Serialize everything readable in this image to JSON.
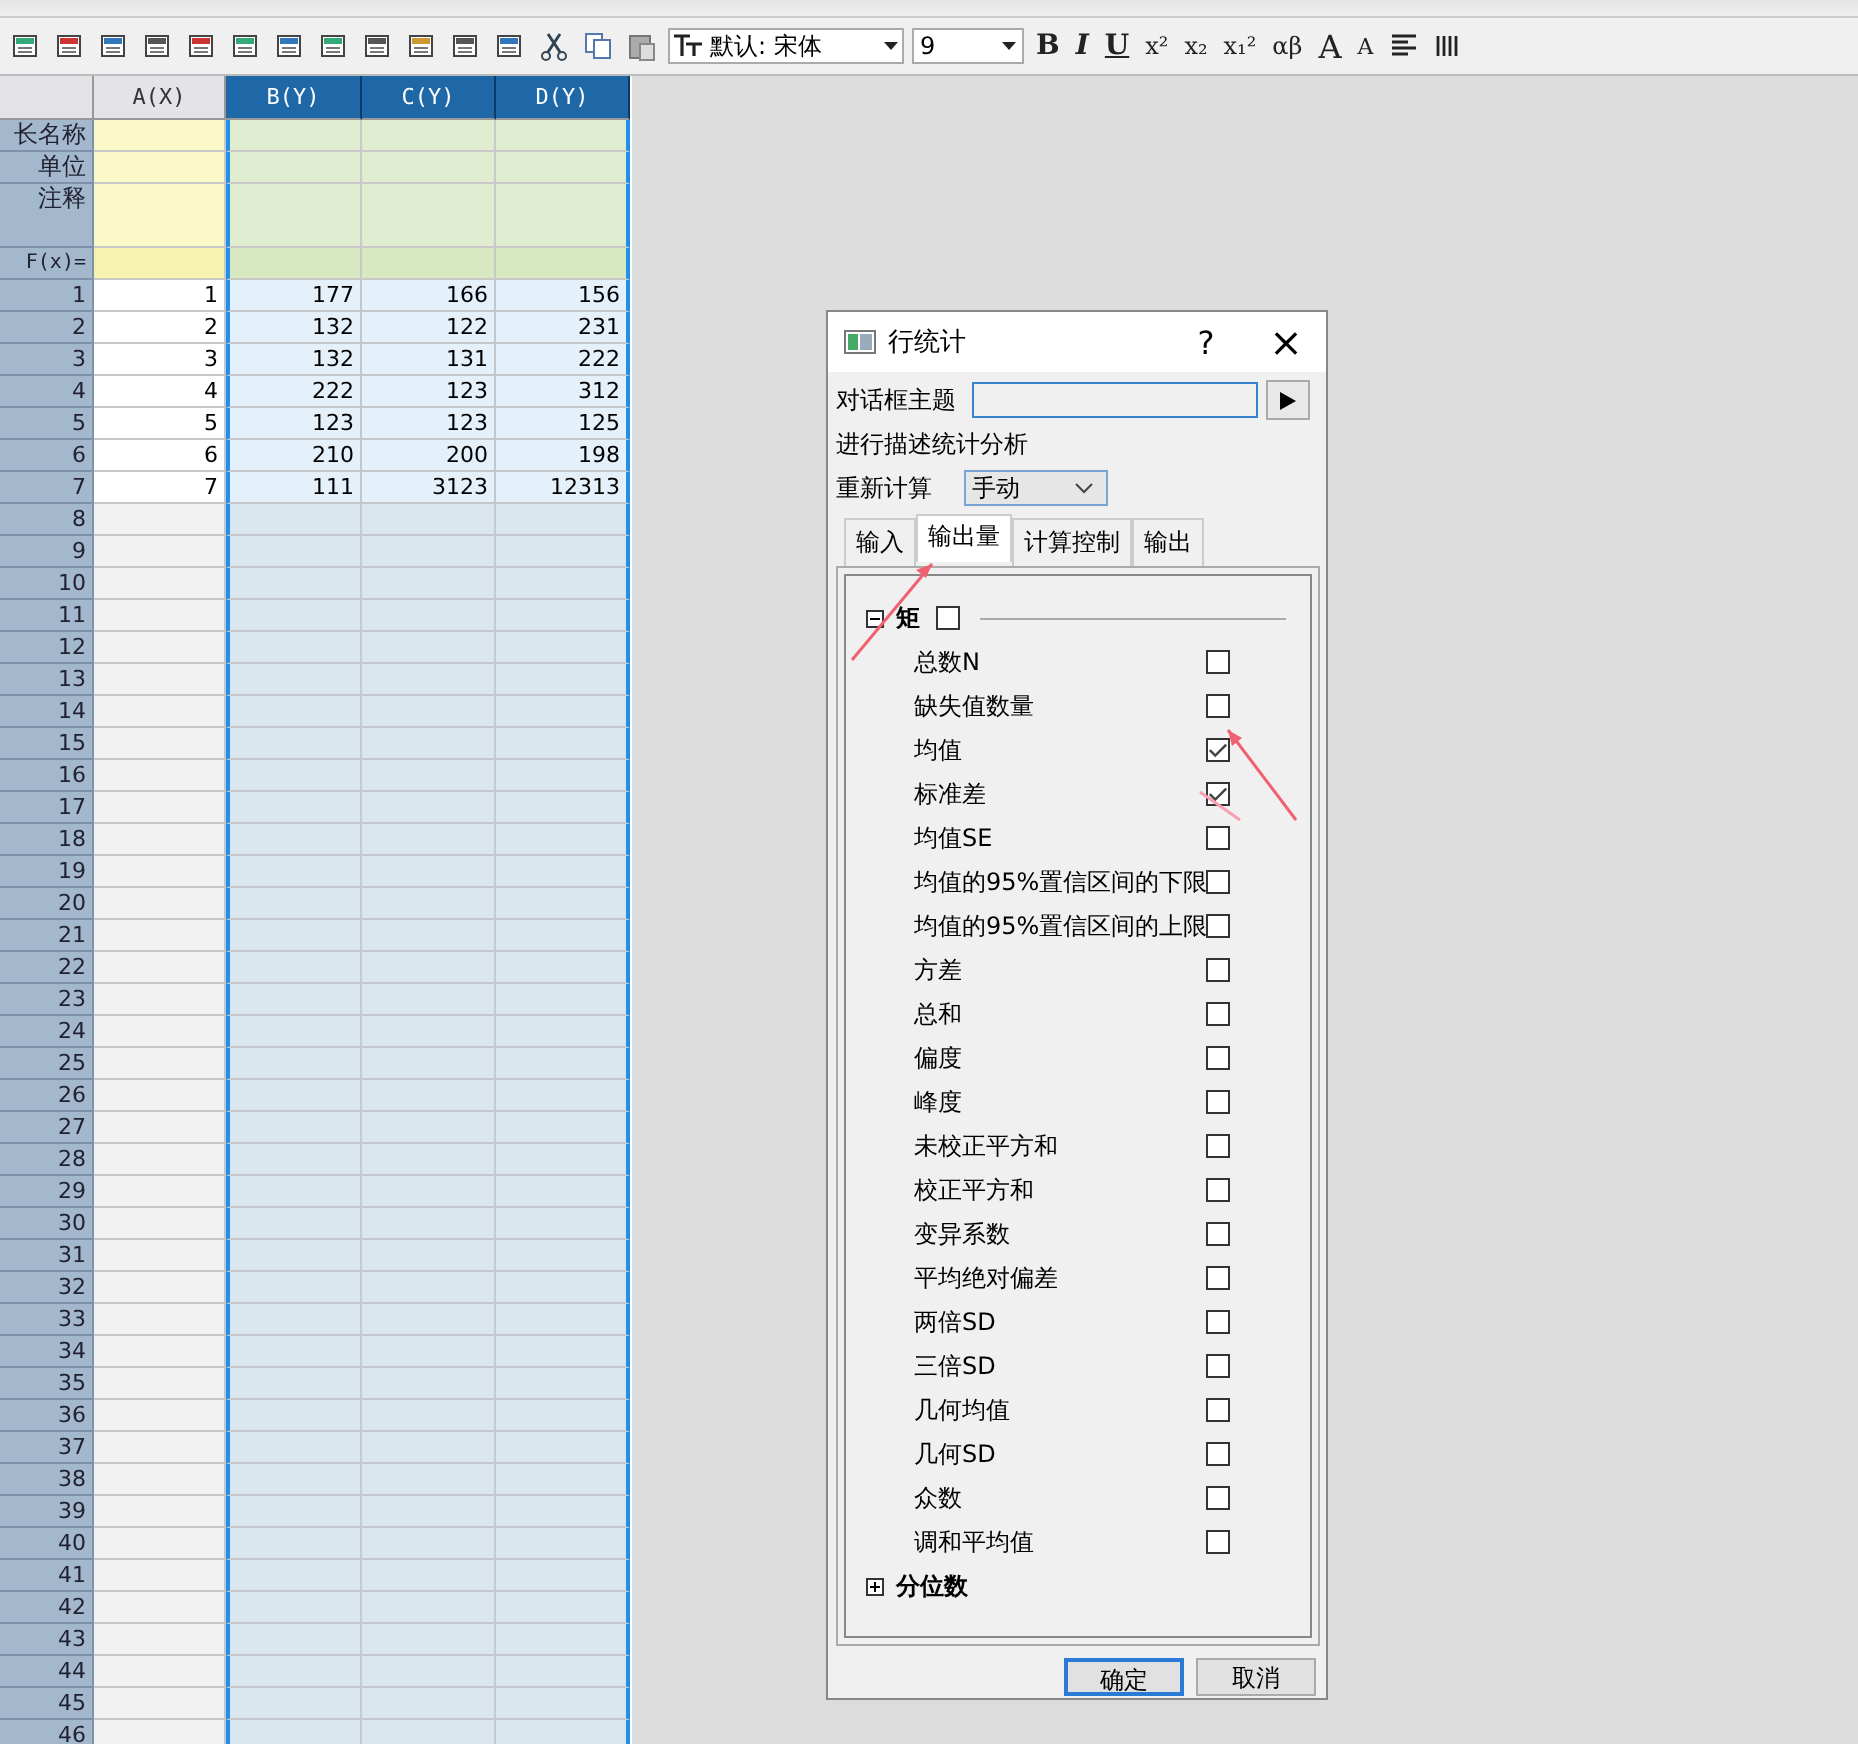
{
  "toolbar": {
    "font": "默认: 宋体",
    "size": "9",
    "format_buttons": [
      {
        "label": "B",
        "kind": "bold"
      },
      {
        "label": "I",
        "kind": "italic"
      },
      {
        "label": "U",
        "kind": "underline"
      },
      {
        "label": "x²",
        "kind": "plain"
      },
      {
        "label": "x₂",
        "kind": "plain"
      },
      {
        "label": "x₁²",
        "kind": "plain"
      },
      {
        "label": "αβ",
        "kind": "plain"
      },
      {
        "label": "A",
        "kind": "big"
      },
      {
        "label": "A",
        "kind": "small"
      }
    ]
  },
  "sheet": {
    "columns": [
      {
        "label": "A(X)",
        "selected": false
      },
      {
        "label": "B(Y)",
        "selected": true
      },
      {
        "label": "C(Y)",
        "selected": true
      },
      {
        "label": "D(Y)",
        "selected": true
      }
    ],
    "meta_rows": [
      {
        "label": "长名称",
        "kind": "short"
      },
      {
        "label": "单位",
        "kind": "short"
      },
      {
        "label": "注释",
        "kind": "tall"
      },
      {
        "label": "F(x)=",
        "kind": "formula"
      }
    ],
    "rows": [
      {
        "label": "1",
        "cells": [
          "1",
          "177",
          "166",
          "156"
        ]
      },
      {
        "label": "2",
        "cells": [
          "2",
          "132",
          "122",
          "231"
        ]
      },
      {
        "label": "3",
        "cells": [
          "3",
          "132",
          "131",
          "222"
        ]
      },
      {
        "label": "4",
        "cells": [
          "4",
          "222",
          "123",
          "312"
        ]
      },
      {
        "label": "5",
        "cells": [
          "5",
          "123",
          "123",
          "125"
        ]
      },
      {
        "label": "6",
        "cells": [
          "6",
          "210",
          "200",
          "198"
        ]
      },
      {
        "label": "7",
        "cells": [
          "7",
          "111",
          "3123",
          "12313"
        ]
      }
    ],
    "empty_rows": [
      "8",
      "9",
      "10",
      "11",
      "12",
      "13",
      "14",
      "15",
      "16",
      "17",
      "18",
      "19",
      "20",
      "21",
      "22",
      "23",
      "24",
      "25",
      "26",
      "27",
      "28",
      "29",
      "30",
      "31",
      "32",
      "33",
      "34",
      "35",
      "36",
      "37",
      "38",
      "39",
      "40",
      "41",
      "42",
      "43",
      "44",
      "45",
      "46"
    ]
  },
  "dialog": {
    "title": "行统计",
    "help": "?",
    "close": "×",
    "theme_label": "对话框主题",
    "description": "进行描述统计分析",
    "recalc_label": "重新计算",
    "recalc_value": "手动",
    "tabs": [
      {
        "label": "输入",
        "selected": false
      },
      {
        "label": "输出量",
        "selected": true
      },
      {
        "label": "计算控制",
        "selected": false
      },
      {
        "label": "输出",
        "selected": false
      }
    ],
    "sections": [
      {
        "title": "矩",
        "expanded": true,
        "checked": false,
        "items": [
          {
            "label": "总数N",
            "checked": false
          },
          {
            "label": "缺失值数量",
            "checked": false
          },
          {
            "label": "均值",
            "checked": true
          },
          {
            "label": "标准差",
            "checked": true
          },
          {
            "label": "均值SE",
            "checked": false
          },
          {
            "label": "均值的95%置信区间的下限",
            "checked": false
          },
          {
            "label": "均值的95%置信区间的上限",
            "checked": false
          },
          {
            "label": "方差",
            "checked": false
          },
          {
            "label": "总和",
            "checked": false
          },
          {
            "label": "偏度",
            "checked": false
          },
          {
            "label": "峰度",
            "checked": false
          },
          {
            "label": "未校正平方和",
            "checked": false
          },
          {
            "label": "校正平方和",
            "checked": false
          },
          {
            "label": "变异系数",
            "checked": false
          },
          {
            "label": "平均绝对偏差",
            "checked": false
          },
          {
            "label": "两倍SD",
            "checked": false
          },
          {
            "label": "三倍SD",
            "checked": false
          },
          {
            "label": "几何均值",
            "checked": false
          },
          {
            "label": "几何SD",
            "checked": false
          },
          {
            "label": "众数",
            "checked": false
          },
          {
            "label": "调和平均值",
            "checked": false
          }
        ]
      },
      {
        "title": "分位数",
        "expanded": false
      }
    ],
    "buttons": [
      {
        "label": "确定",
        "kind": "default"
      },
      {
        "label": "取消",
        "kind": "normal"
      }
    ]
  }
}
